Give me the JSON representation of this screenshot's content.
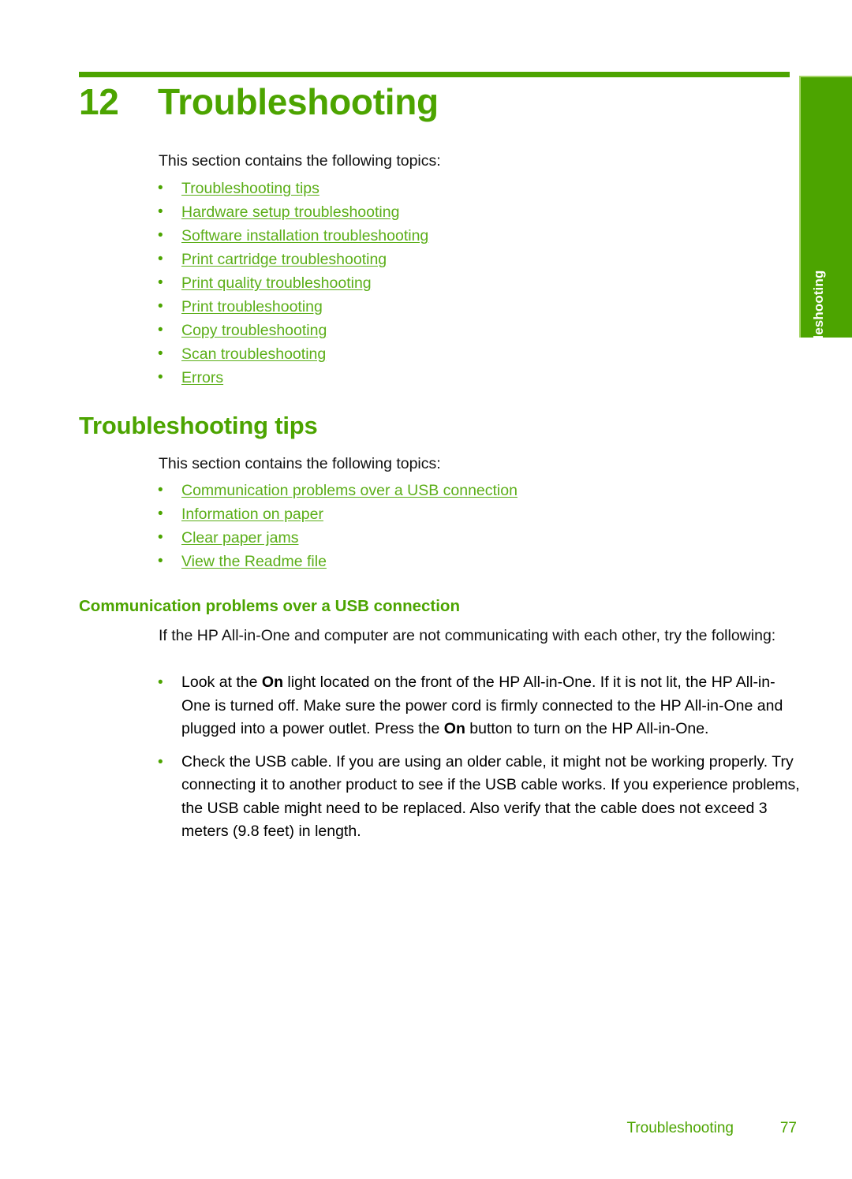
{
  "chapter": {
    "number": "12",
    "title": "Troubleshooting"
  },
  "side_tab": {
    "label": "Troubleshooting"
  },
  "intro": {
    "text": "This section contains the following topics:"
  },
  "toc_main": [
    {
      "label": "Troubleshooting tips"
    },
    {
      "label": "Hardware setup troubleshooting"
    },
    {
      "label": "Software installation troubleshooting"
    },
    {
      "label": "Print cartridge troubleshooting"
    },
    {
      "label": "Print quality troubleshooting"
    },
    {
      "label": "Print troubleshooting"
    },
    {
      "label": "Copy troubleshooting"
    },
    {
      "label": "Scan troubleshooting"
    },
    {
      "label": "Errors"
    }
  ],
  "section_tips": {
    "heading": "Troubleshooting tips",
    "intro": "This section contains the following topics:",
    "toc": [
      {
        "label": "Communication problems over a USB connection"
      },
      {
        "label": "Information on paper"
      },
      {
        "label": "Clear paper jams"
      },
      {
        "label": "View the Readme file"
      }
    ]
  },
  "section_usb": {
    "heading": "Communication problems over a USB connection",
    "intro": "If the HP All-in-One and computer are not communicating with each other, try the following:",
    "bullets": [
      {
        "part1": "Look at the ",
        "bold1": "On",
        "part2": " light located on the front of the HP All-in-One. If it is not lit, the HP All-in-One is turned off. Make sure the power cord is firmly connected to the HP All-in-One and plugged into a power outlet. Press the ",
        "bold2": "On",
        "part3": " button to turn on the HP All-in-One."
      },
      {
        "text": "Check the USB cable. If you are using an older cable, it might not be working properly. Try connecting it to another product to see if the USB cable works. If you experience problems, the USB cable might need to be replaced. Also verify that the cable does not exceed 3 meters (9.8 feet) in length."
      }
    ]
  },
  "footer": {
    "chapter_label": "Troubleshooting",
    "page_number": "77"
  },
  "colors": {
    "accent_green": "#4CA400",
    "link_green": "#5BAE18",
    "body_black": "#111111"
  },
  "bullet_glyph": "•"
}
